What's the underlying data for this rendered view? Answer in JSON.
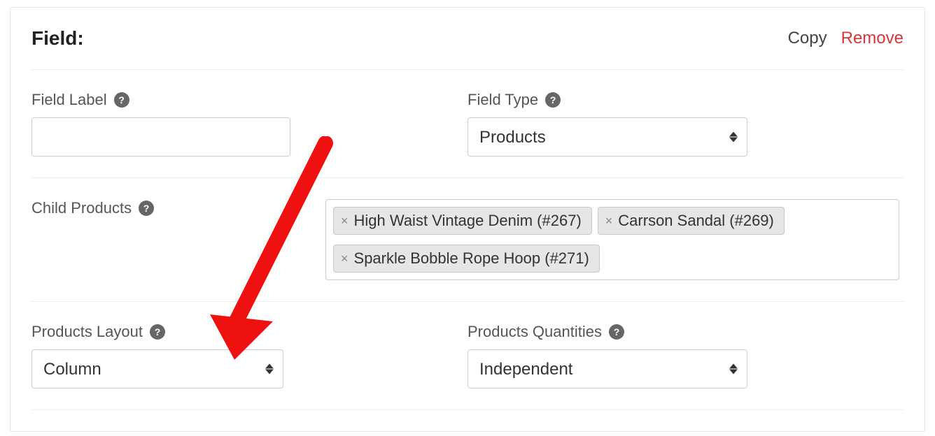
{
  "panel": {
    "title": "Field:",
    "copy_label": "Copy",
    "remove_label": "Remove"
  },
  "field_label": {
    "label": "Field Label",
    "value": ""
  },
  "field_type": {
    "label": "Field Type",
    "selected": "Products"
  },
  "child_products": {
    "label": "Child Products",
    "tags": [
      "High Waist Vintage Denim (#267)",
      "Carrson Sandal (#269)",
      "Sparkle Bobble Rope Hoop (#271)"
    ]
  },
  "products_layout": {
    "label": "Products Layout",
    "selected": "Column"
  },
  "products_quantities": {
    "label": "Products Quantities",
    "selected": "Independent"
  }
}
